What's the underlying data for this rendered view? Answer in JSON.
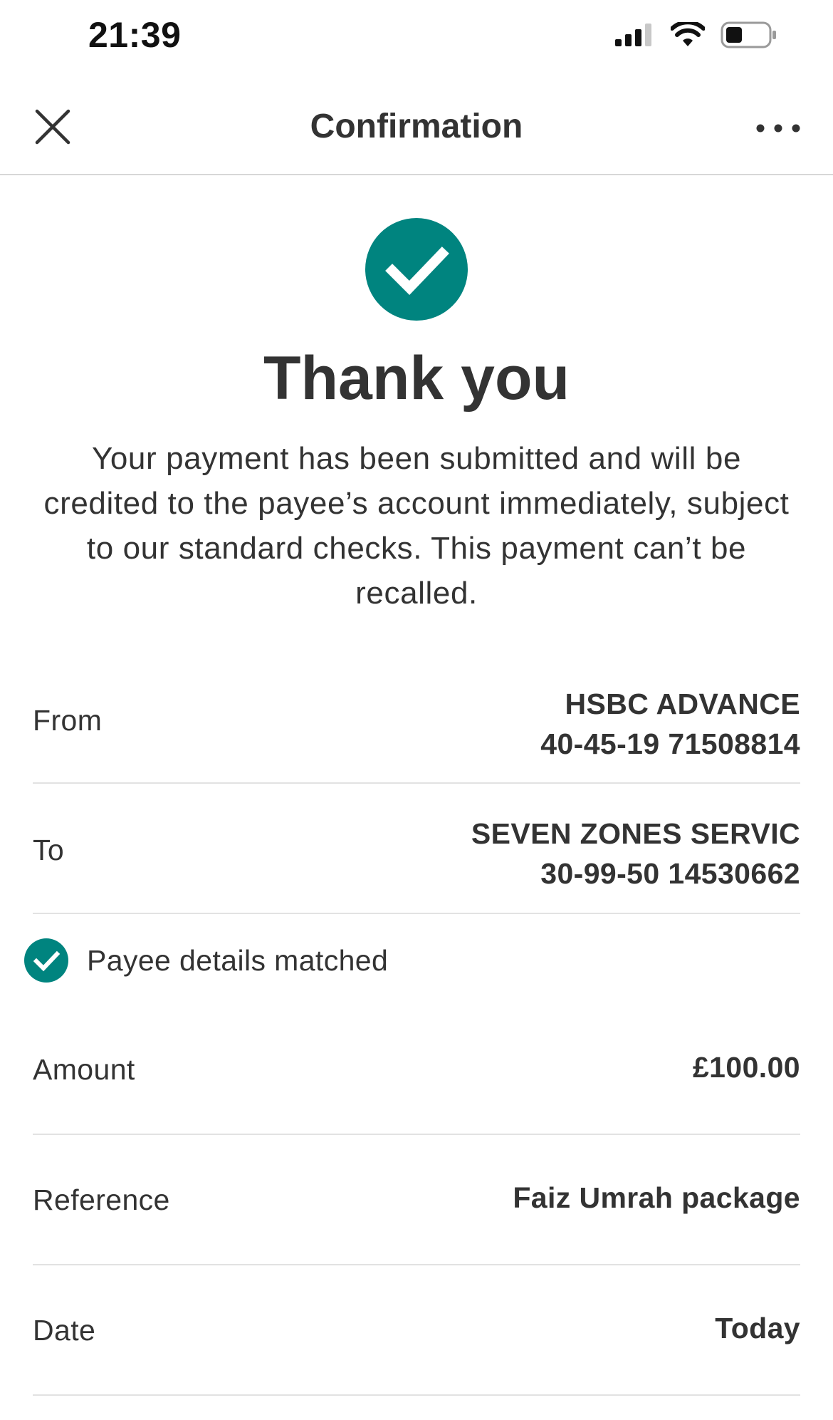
{
  "status_bar": {
    "time": "21:39",
    "icons": [
      "signal-icon",
      "wifi-icon",
      "battery-icon"
    ]
  },
  "header": {
    "title": "Confirmation",
    "close_icon": "close-icon",
    "more_icon": "more-options-icon"
  },
  "success": {
    "icon": "check-circle-icon",
    "heading": "Thank you",
    "message": "Your payment has been submitted and will be credited to the payee’s account immediately, subject to our standard checks. This payment can’t be recalled."
  },
  "details": {
    "from": {
      "label": "From",
      "account_name": "HSBC ADVANCE",
      "account_number": "40-45-19 71508814"
    },
    "to": {
      "label": "To",
      "payee_name": "SEVEN ZONES SERVIC",
      "account_number": "30-99-50 14530662"
    },
    "payee_match": {
      "icon": "check-circle-icon",
      "label": "Payee details matched"
    },
    "amount": {
      "label": "Amount",
      "value": "£100.00"
    },
    "reference": {
      "label": "Reference",
      "value": "Faiz Umrah package"
    },
    "date": {
      "label": "Date",
      "value": "Today"
    }
  },
  "colors": {
    "accent": "#00847f",
    "text": "#333333",
    "divider": "#e2e2e2"
  }
}
